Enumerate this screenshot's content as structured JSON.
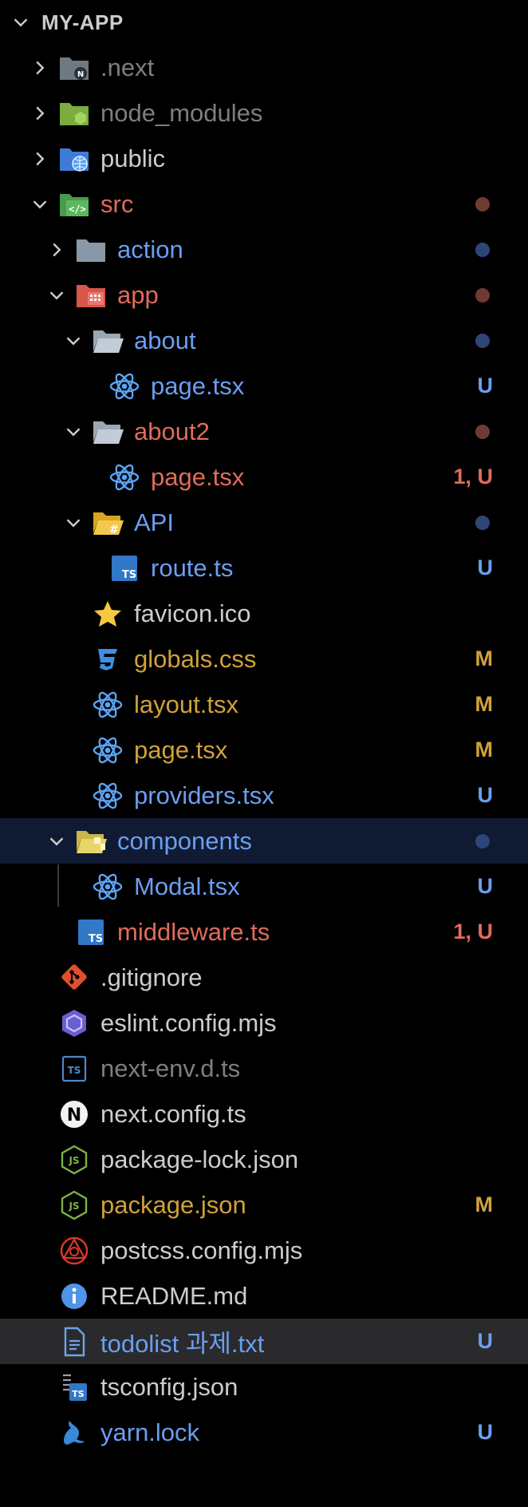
{
  "explorer": {
    "title": "MY-APP",
    "colors": {
      "untracked": "#6b9ef0",
      "modified": "#d1a13a",
      "error": "#e06c5a",
      "ignored": "#7e7e7e",
      "normal": "#cccccc",
      "dot_error": "#6e3a33",
      "dot_untracked": "#2e4677"
    },
    "items": [
      {
        "label": ".next",
        "icon": "next-folder-icon",
        "kind": "folder",
        "expanded": false,
        "status": "ignored"
      },
      {
        "label": "node_modules",
        "icon": "node-folder-icon",
        "kind": "folder",
        "expanded": false,
        "status": "ignored"
      },
      {
        "label": "public",
        "icon": "public-folder-icon",
        "kind": "folder",
        "expanded": false,
        "status": "normal"
      },
      {
        "label": "src",
        "icon": "src-folder-icon",
        "kind": "folder",
        "expanded": true,
        "status": "error",
        "dot": true
      },
      {
        "label": "action",
        "icon": "folder-icon",
        "kind": "folder",
        "expanded": false,
        "status": "untracked",
        "dot": true
      },
      {
        "label": "app",
        "icon": "app-folder-icon",
        "kind": "folder",
        "expanded": true,
        "status": "error",
        "dot": true
      },
      {
        "label": "about",
        "icon": "folder-open-icon",
        "kind": "folder",
        "expanded": true,
        "status": "untracked",
        "dot": true
      },
      {
        "label": "page.tsx",
        "icon": "react-icon",
        "kind": "file",
        "status": "untracked",
        "badge": "U"
      },
      {
        "label": "about2",
        "icon": "folder-open-icon",
        "kind": "folder",
        "expanded": true,
        "status": "error",
        "dot": true
      },
      {
        "label": "page.tsx",
        "icon": "react-icon",
        "kind": "file",
        "status": "error",
        "badge": "1, U"
      },
      {
        "label": "API",
        "icon": "api-folder-icon",
        "kind": "folder",
        "expanded": true,
        "status": "untracked",
        "dot": true
      },
      {
        "label": "route.ts",
        "icon": "typescript-icon",
        "kind": "file",
        "status": "untracked",
        "badge": "U"
      },
      {
        "label": "favicon.ico",
        "icon": "star-icon",
        "kind": "file",
        "status": "normal"
      },
      {
        "label": "globals.css",
        "icon": "css-icon",
        "kind": "file",
        "status": "modified",
        "badge": "M"
      },
      {
        "label": "layout.tsx",
        "icon": "react-icon",
        "kind": "file",
        "status": "modified",
        "badge": "M"
      },
      {
        "label": "page.tsx",
        "icon": "react-icon",
        "kind": "file",
        "status": "modified",
        "badge": "M"
      },
      {
        "label": "providers.tsx",
        "icon": "react-icon",
        "kind": "file",
        "status": "untracked",
        "badge": "U"
      },
      {
        "label": "components",
        "icon": "components-folder-icon",
        "kind": "folder",
        "expanded": true,
        "status": "untracked",
        "dot": true,
        "selected": true
      },
      {
        "label": "Modal.tsx",
        "icon": "react-icon",
        "kind": "file",
        "status": "untracked",
        "badge": "U"
      },
      {
        "label": "middleware.ts",
        "icon": "typescript-icon",
        "kind": "file",
        "status": "error",
        "badge": "1, U"
      },
      {
        "label": ".gitignore",
        "icon": "git-icon",
        "kind": "file",
        "status": "normal"
      },
      {
        "label": "eslint.config.mjs",
        "icon": "eslint-icon",
        "kind": "file",
        "status": "normal"
      },
      {
        "label": "next-env.d.ts",
        "icon": "typescript-def-icon",
        "kind": "file",
        "status": "ignored"
      },
      {
        "label": "next.config.ts",
        "icon": "next-icon",
        "kind": "file",
        "status": "normal"
      },
      {
        "label": "package-lock.json",
        "icon": "nodejs-icon",
        "kind": "file",
        "status": "normal"
      },
      {
        "label": "package.json",
        "icon": "nodejs-icon",
        "kind": "file",
        "status": "modified",
        "badge": "M"
      },
      {
        "label": "postcss.config.mjs",
        "icon": "postcss-icon",
        "kind": "file",
        "status": "normal"
      },
      {
        "label": "README.md",
        "icon": "info-icon",
        "kind": "file",
        "status": "normal"
      },
      {
        "label": "todolist 과제.txt",
        "icon": "text-file-icon",
        "kind": "file",
        "status": "untracked",
        "badge": "U",
        "hovered": true
      },
      {
        "label": "tsconfig.json",
        "icon": "tsconfig-icon",
        "kind": "file",
        "status": "normal"
      },
      {
        "label": "yarn.lock",
        "icon": "yarn-icon",
        "kind": "file",
        "status": "untracked",
        "badge": "U"
      }
    ]
  }
}
